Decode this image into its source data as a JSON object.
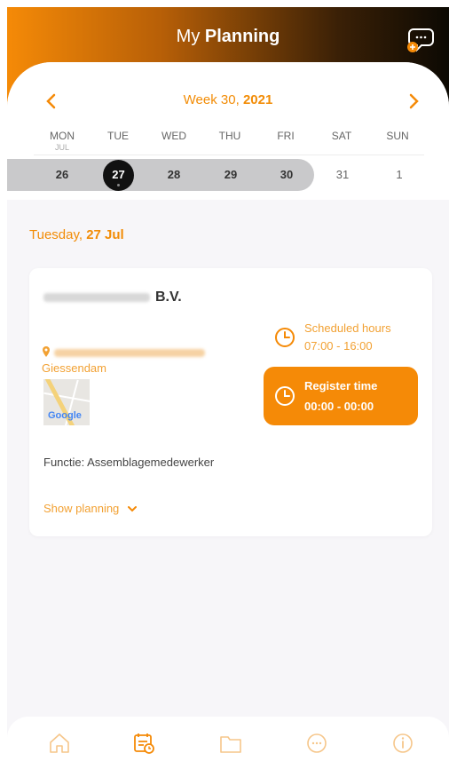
{
  "header": {
    "title_prefix": "My",
    "title_bold": "Planning",
    "chat_icon": "chat-add-icon"
  },
  "week": {
    "prefix": "Week 30,",
    "year": "2021",
    "prev_icon": "chevron-left-icon",
    "next_icon": "chevron-right-icon"
  },
  "days": {
    "names": [
      "MON",
      "TUE",
      "WED",
      "THU",
      "FRI",
      "SAT",
      "SUN"
    ],
    "month_label": "JUL",
    "dates": [
      "26",
      "27",
      "28",
      "29",
      "30",
      "31",
      "1"
    ],
    "selected": "27"
  },
  "day_title": {
    "weekday": "Tuesday,",
    "date": "27 Jul"
  },
  "card": {
    "company_suffix": "B.V.",
    "city": "Giessendam",
    "map_label": "Google",
    "function": "Functie: Assemblagemedewerker",
    "show_planning": "Show planning",
    "scheduled_label": "Scheduled hours",
    "scheduled_time": "07:00 - 16:00",
    "register_label": "Register time",
    "register_time": "00:00 - 00:00"
  },
  "tabs": [
    "home-icon",
    "planning-icon",
    "folder-icon",
    "chat-icon",
    "info-icon"
  ],
  "colors": {
    "accent": "#f58a07",
    "accent_light": "#f2a133",
    "header_dark": "#0c0903"
  }
}
